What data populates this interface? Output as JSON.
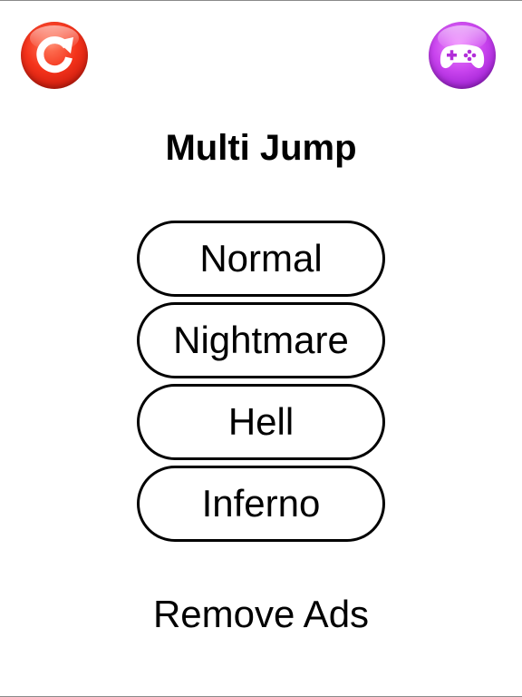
{
  "header": {
    "restart_button": {
      "icon": "restart-icon",
      "color": "#e62a17"
    },
    "games_button": {
      "icon": "gamepad-icon",
      "color": "#c23ee6"
    }
  },
  "title": "Multi Jump",
  "modes": [
    {
      "label": "Normal"
    },
    {
      "label": "Nightmare"
    },
    {
      "label": "Hell"
    },
    {
      "label": "Inferno"
    }
  ],
  "remove_ads_label": "Remove Ads"
}
